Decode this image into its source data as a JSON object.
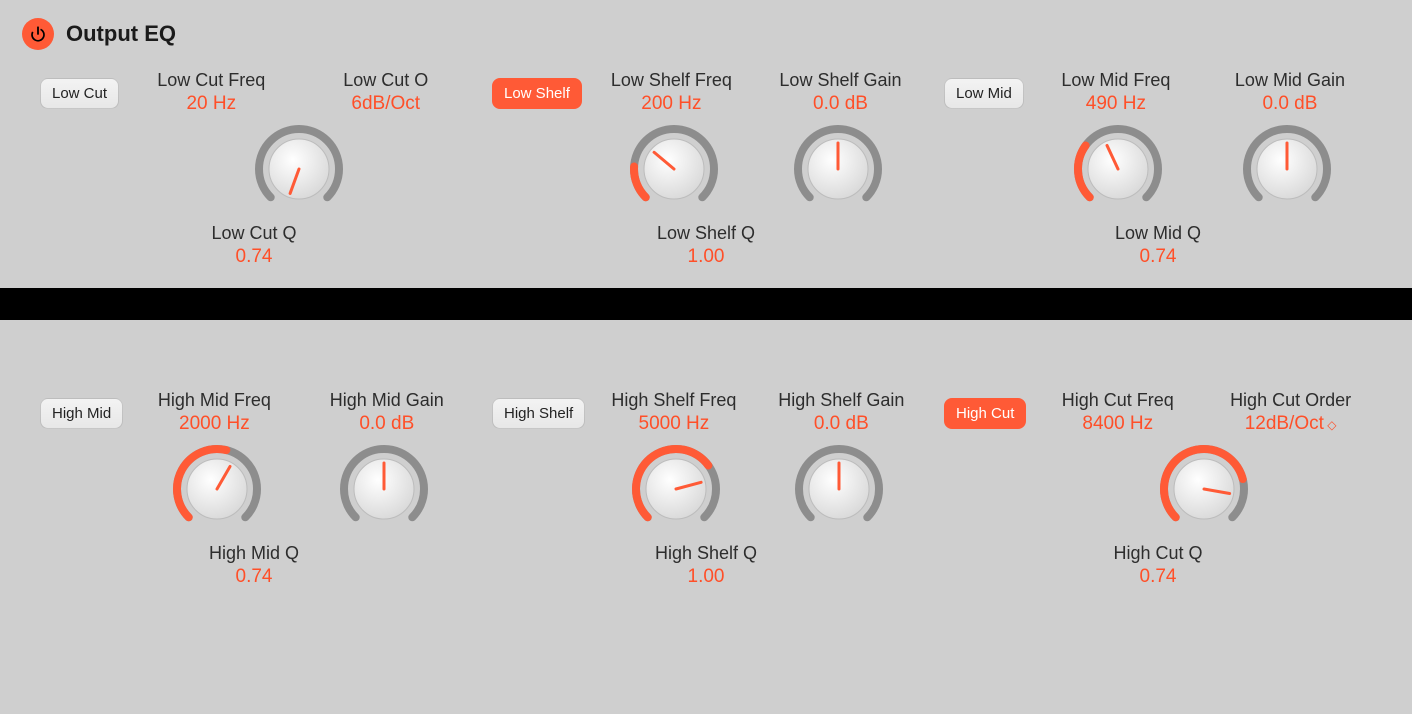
{
  "title": "Output EQ",
  "colors": {
    "accent": "#ff5a36",
    "bg": "#cfcfcf"
  },
  "bands": {
    "lowcut": {
      "button": "Low Cut",
      "active": false,
      "freq_label": "Low Cut Freq",
      "freq": "20 Hz",
      "freq_angle": 200,
      "freq_fill": 0,
      "order_label": "Low Cut O",
      "order": "6dB/Oct",
      "q_label": "Low Cut Q",
      "q": "0.74"
    },
    "lowshelf": {
      "button": "Low Shelf",
      "active": true,
      "freq_label": "Low Shelf Freq",
      "freq": "200 Hz",
      "freq_angle": 310,
      "freq_fill": 0.18,
      "gain_label": "Low Shelf Gain",
      "gain": "0.0 dB",
      "gain_angle": 0,
      "q_label": "Low Shelf Q",
      "q": "1.00"
    },
    "lowmid": {
      "button": "Low Mid",
      "active": false,
      "freq_label": "Low Mid Freq",
      "freq": "490 Hz",
      "freq_angle": 335,
      "freq_fill": 0.3,
      "gain_label": "Low Mid Gain",
      "gain": "0.0 dB",
      "gain_angle": 0,
      "q_label": "Low Mid Q",
      "q": "0.74"
    },
    "highmid": {
      "button": "High Mid",
      "active": false,
      "freq_label": "High Mid Freq",
      "freq": "2000 Hz",
      "freq_angle": 30,
      "freq_fill": 0.55,
      "gain_label": "High Mid Gain",
      "gain": "0.0 dB",
      "gain_angle": 0,
      "q_label": "High Mid Q",
      "q": "0.74"
    },
    "highshelf": {
      "button": "High Shelf",
      "active": false,
      "freq_label": "High Shelf Freq",
      "freq": "5000 Hz",
      "freq_angle": 75,
      "freq_fill": 0.7,
      "gain_label": "High Shelf Gain",
      "gain": "0.0 dB",
      "gain_angle": 0,
      "q_label": "High Shelf Q",
      "q": "1.00"
    },
    "highcut": {
      "button": "High Cut",
      "active": true,
      "freq_label": "High Cut Freq",
      "freq": "8400 Hz",
      "freq_angle": 100,
      "freq_fill": 0.78,
      "order_label": "High Cut Order",
      "order": "12dB/Oct",
      "q_label": "High Cut Q",
      "q": "0.74"
    }
  }
}
